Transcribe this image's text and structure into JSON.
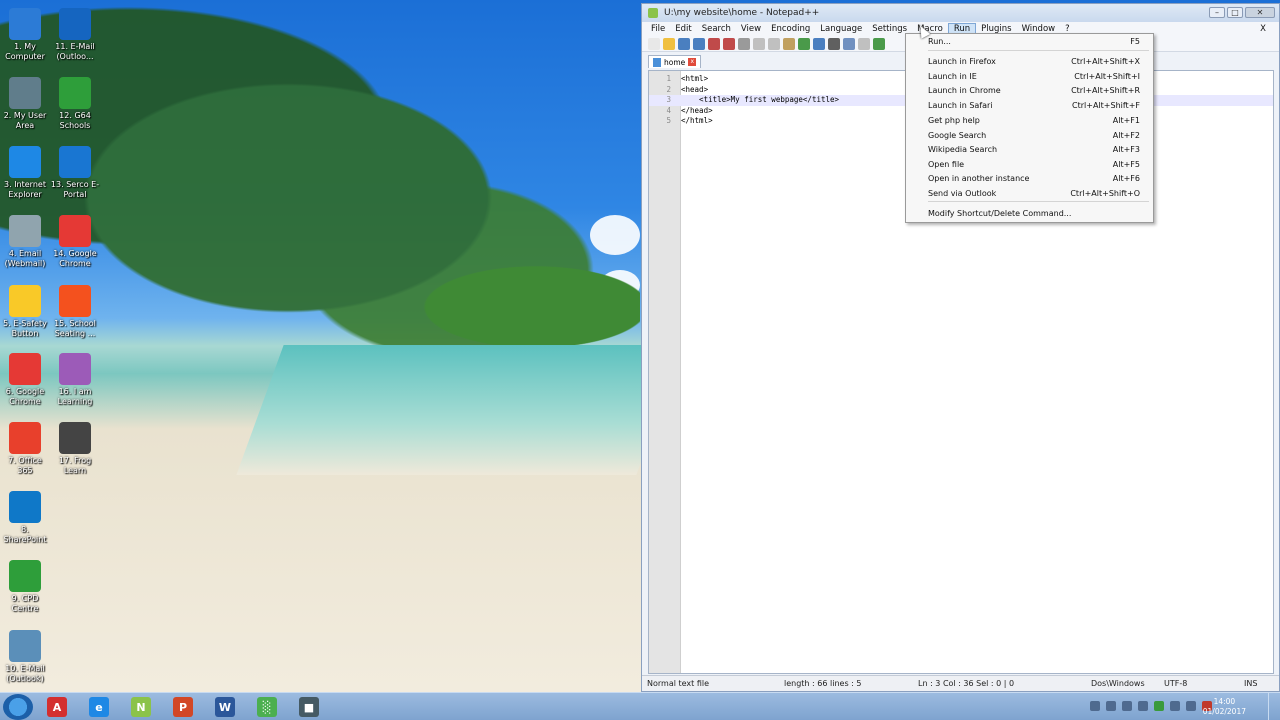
{
  "desktop": {
    "icons": [
      {
        "label": "1. My Computer",
        "icon": "computer-icon",
        "color": "#2c7bd6"
      },
      {
        "label": "11. E-Mail (Outloo...",
        "icon": "outlook-icon",
        "color": "#1565c0"
      },
      {
        "label": "2. My User Area",
        "icon": "user-area-icon",
        "color": "#607d8b"
      },
      {
        "label": "12. G64 Schools",
        "icon": "g64-icon",
        "color": "#2e9e3a"
      },
      {
        "label": "3. Internet Explorer",
        "icon": "internet-explorer-icon",
        "color": "#1e88e5"
      },
      {
        "label": "13. Serco E-Portal",
        "icon": "eportal-icon",
        "color": "#1976d2"
      },
      {
        "label": "4. Email (Webmail)",
        "icon": "webmail-icon",
        "color": "#90a4ae"
      },
      {
        "label": "14. Google Chrome",
        "icon": "chrome-icon",
        "color": "#e53935"
      },
      {
        "label": "5. E-Safety Button",
        "icon": "esafety-icon",
        "color": "#f9c928"
      },
      {
        "label": "15. School Seating ...",
        "icon": "seating-icon",
        "color": "#f4511e"
      },
      {
        "label": "6. Google Chrome",
        "icon": "chrome-icon",
        "color": "#e53935"
      },
      {
        "label": "16. I am Learning",
        "icon": "iamlearning-icon",
        "color": "#9c5bb8"
      },
      {
        "label": "7. Office 365",
        "icon": "office365-icon",
        "color": "#e8402c"
      },
      {
        "label": "17. Frog Learn",
        "icon": "froglearn-icon",
        "color": "#444444"
      },
      {
        "label": "8. SharePoint",
        "icon": "sharepoint-icon",
        "color": "#0f78c8"
      },
      {
        "label": "9. CPD Centre",
        "icon": "cpd-icon",
        "color": "#2e9e3a"
      },
      {
        "label": "10. E-Mail (Outlook)",
        "icon": "outlook-icon",
        "color": "#5b8fb9"
      }
    ]
  },
  "window": {
    "title": "U:\\my website\\home - Notepad++",
    "menu": [
      "File",
      "Edit",
      "Search",
      "View",
      "Encoding",
      "Language",
      "Settings",
      "Macro",
      "Run",
      "Plugins",
      "Window",
      "?"
    ],
    "menu_close": "X",
    "min": "–",
    "max": "□",
    "close": "✕",
    "tab_label": "home",
    "lines": [
      {
        "num": "1",
        "text": "<html>"
      },
      {
        "num": "2",
        "text": "<head>"
      },
      {
        "num": "3",
        "text": "    <title>My first webpage</title>"
      },
      {
        "num": "4",
        "text": "</head>"
      },
      {
        "num": "5",
        "text": "</html>"
      }
    ],
    "status": {
      "type": "Normal text file",
      "length": "length : 66   lines : 5",
      "position": "Ln : 3   Col : 36   Sel : 0 | 0",
      "eol": "Dos\\Windows",
      "encoding": "UTF-8",
      "mode": "INS"
    }
  },
  "run_menu": {
    "items": [
      {
        "label": "Run...",
        "shortcut": "F5"
      },
      {
        "label": "Launch in Firefox",
        "shortcut": "Ctrl+Alt+Shift+X"
      },
      {
        "label": "Launch in IE",
        "shortcut": "Ctrl+Alt+Shift+I"
      },
      {
        "label": "Launch in Chrome",
        "shortcut": "Ctrl+Alt+Shift+R"
      },
      {
        "label": "Launch in Safari",
        "shortcut": "Ctrl+Alt+Shift+F"
      },
      {
        "label": "Get php help",
        "shortcut": "Alt+F1"
      },
      {
        "label": "Google Search",
        "shortcut": "Alt+F2"
      },
      {
        "label": "Wikipedia Search",
        "shortcut": "Alt+F3"
      },
      {
        "label": "Open file",
        "shortcut": "Alt+F5"
      },
      {
        "label": "Open in another instance",
        "shortcut": "Alt+F6"
      },
      {
        "label": "Send via Outlook",
        "shortcut": "Ctrl+Alt+Shift+O"
      },
      {
        "label": "Modify Shortcut/Delete Command...",
        "shortcut": ""
      }
    ]
  },
  "taskbar": {
    "apps": [
      {
        "name": "pdf-reader",
        "icon": "pdf-icon",
        "color": "#d32f2f",
        "glyph": "A"
      },
      {
        "name": "internet-explorer",
        "icon": "internet-explorer-icon",
        "color": "#1e88e5",
        "glyph": "e"
      },
      {
        "name": "notepad-plus-plus",
        "icon": "notepadpp-icon",
        "color": "#8bc34a",
        "glyph": "N"
      },
      {
        "name": "powerpoint",
        "icon": "powerpoint-icon",
        "color": "#d24726",
        "glyph": "P"
      },
      {
        "name": "word",
        "icon": "word-icon",
        "color": "#2b579a",
        "glyph": "W"
      },
      {
        "name": "publisher",
        "icon": "chart-app-icon",
        "color": "#4caf50",
        "glyph": "░"
      },
      {
        "name": "screen-recorder",
        "icon": "recorder-icon",
        "color": "#455a64",
        "glyph": "■"
      }
    ],
    "time": "14:00",
    "date": "01/02/2017"
  }
}
